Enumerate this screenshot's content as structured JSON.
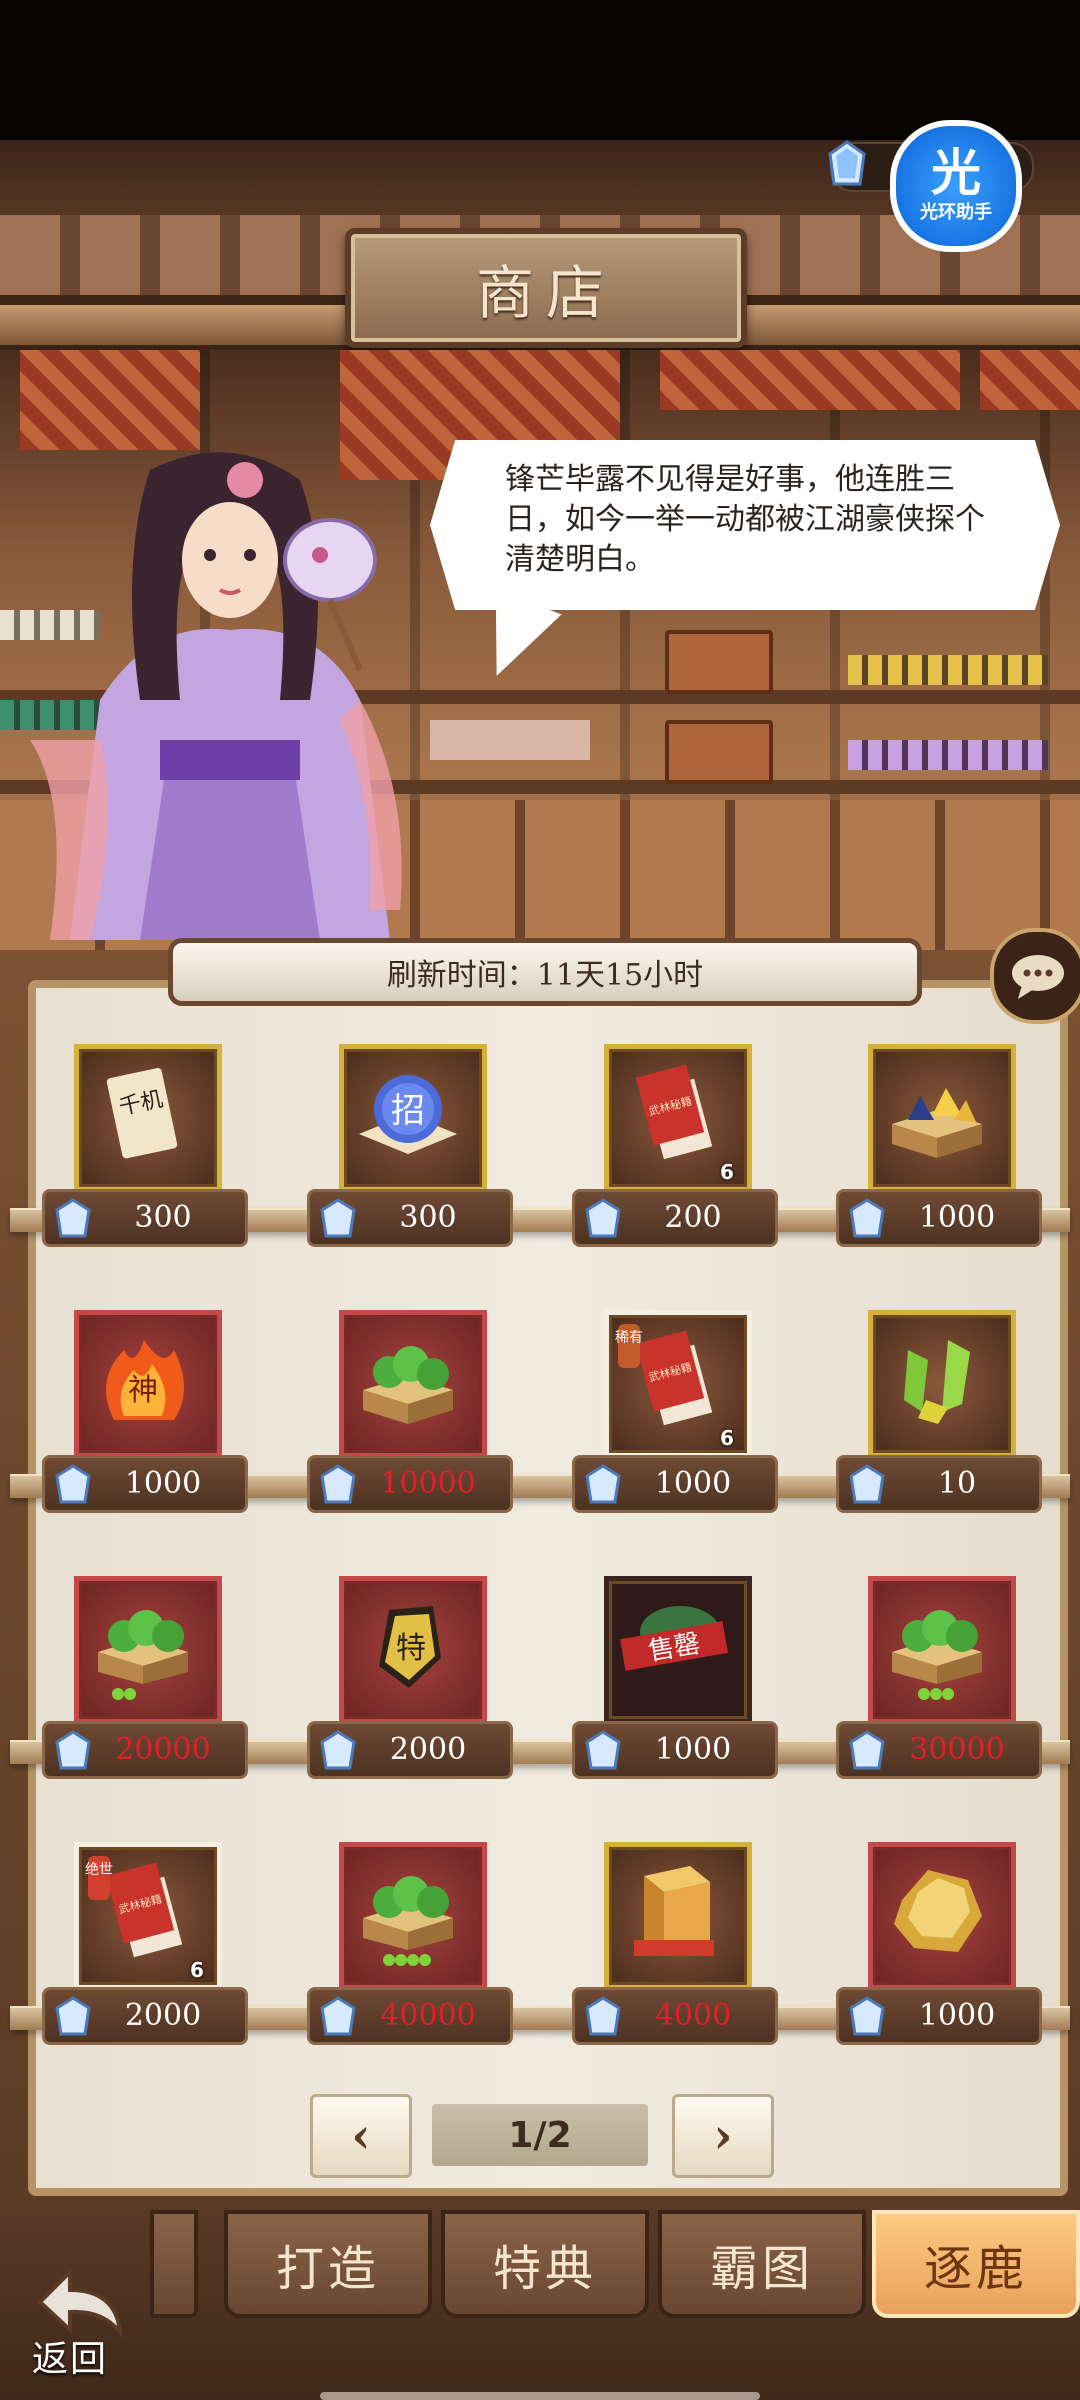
{
  "header": {
    "title": "商店"
  },
  "helper": {
    "label_big": "光",
    "label_small": "光环助手"
  },
  "dialogue": {
    "text": "锋芒毕露不见得是好事，他连胜三日，如今一举一动都被江湖豪侠探个清楚明白。"
  },
  "refresh": {
    "text": "刷新时间：11天15小时"
  },
  "items": [
    {
      "icon": "scroll-qianji",
      "frame": "gold",
      "price": "300",
      "price_red": false,
      "count": ""
    },
    {
      "icon": "blue-orb-zhao",
      "frame": "gold",
      "price": "300",
      "price_red": false,
      "count": ""
    },
    {
      "icon": "red-book",
      "frame": "gold",
      "price": "200",
      "price_red": false,
      "count": "6"
    },
    {
      "icon": "gem-chest",
      "frame": "gold",
      "price": "1000",
      "price_red": false,
      "count": ""
    },
    {
      "icon": "fire-shen",
      "frame": "red",
      "price": "1000",
      "price_red": false,
      "count": ""
    },
    {
      "icon": "jade-chest",
      "frame": "red",
      "price": "10000",
      "price_red": true,
      "count": ""
    },
    {
      "icon": "red-book-rare",
      "frame": "white",
      "price": "1000",
      "price_red": false,
      "count": "6"
    },
    {
      "icon": "jade-shards",
      "frame": "gold",
      "price": "10",
      "price_red": false,
      "count": ""
    },
    {
      "icon": "jade-chest-99",
      "frame": "red",
      "price": "20000",
      "price_red": true,
      "count": ""
    },
    {
      "icon": "gold-special",
      "frame": "red",
      "price": "2000",
      "price_red": false,
      "count": ""
    },
    {
      "icon": "sold-out",
      "frame": "dark",
      "price": "1000",
      "price_red": false,
      "count": ""
    },
    {
      "icon": "jade-chest-999",
      "frame": "red",
      "price": "30000",
      "price_red": true,
      "count": ""
    },
    {
      "icon": "red-book-unique",
      "frame": "white",
      "price": "2000",
      "price_red": false,
      "count": "6"
    },
    {
      "icon": "jade-chest-9999",
      "frame": "red",
      "price": "40000",
      "price_red": true,
      "count": ""
    },
    {
      "icon": "golden-crate",
      "frame": "gold",
      "price": "4000",
      "price_red": true,
      "count": ""
    },
    {
      "icon": "gold-nugget",
      "frame": "red",
      "price": "1000",
      "price_red": false,
      "count": ""
    }
  ],
  "item_labels": {
    "qianji": "千机",
    "zhao": "招",
    "shen": "神",
    "te": "特",
    "sold_out": "售罄",
    "rare": "稀有",
    "unique": "绝世",
    "book": "武林秘籍"
  },
  "pagination": {
    "prev": "‹",
    "next": "›",
    "current": "1/2"
  },
  "tabs": [
    {
      "label": "打造",
      "active": false
    },
    {
      "label": "特典",
      "active": false
    },
    {
      "label": "霸图",
      "active": false
    },
    {
      "label": "逐鹿",
      "active": true
    }
  ],
  "back": {
    "label": "返回"
  },
  "colors": {
    "price_red": "#e0202a",
    "gold_frame": "#d6b13a",
    "red_frame": "#c5484a",
    "active_tab": "#ffc982"
  }
}
